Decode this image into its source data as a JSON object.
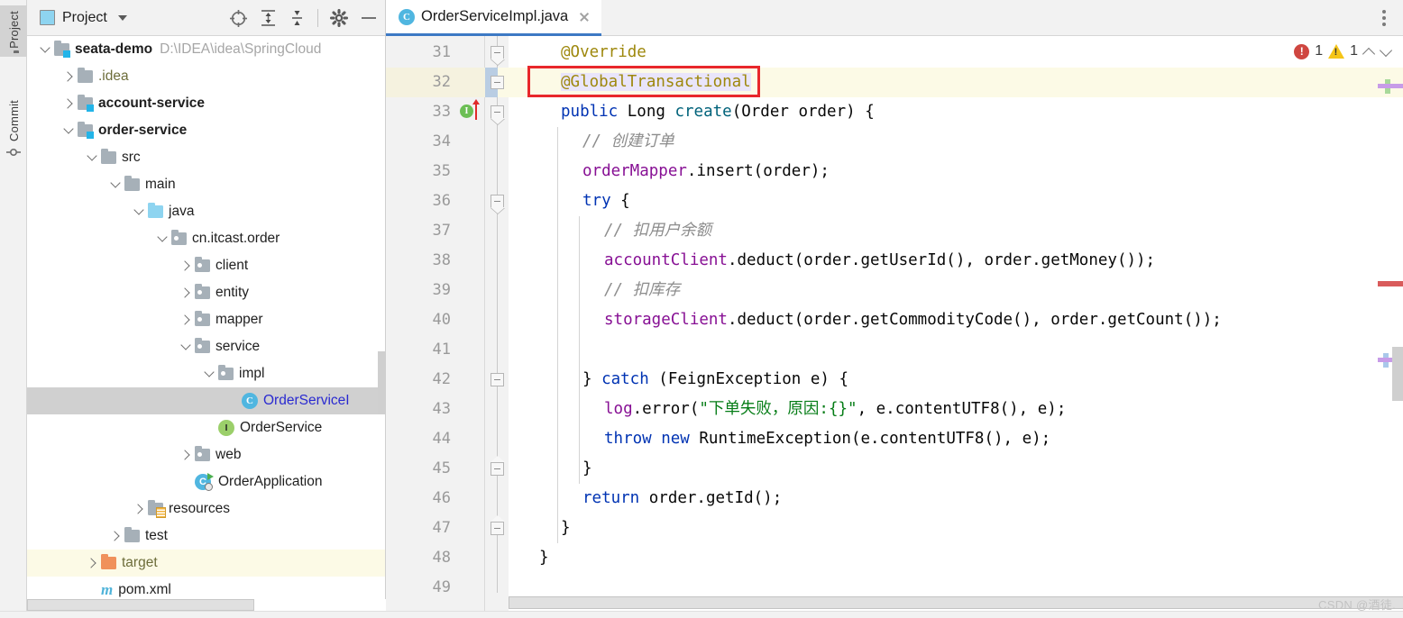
{
  "toolstrip": {
    "items": [
      {
        "label": "Project",
        "icon": "folder-icon",
        "active": true
      },
      {
        "label": "Commit",
        "icon": "commit-icon",
        "active": false
      }
    ]
  },
  "project_panel": {
    "title": "Project",
    "dropdown_icon": "chevron-down-icon",
    "tools": [
      {
        "name": "locate-icon"
      },
      {
        "name": "expand-all-icon"
      },
      {
        "name": "collapse-all-icon"
      },
      {
        "name": "gear-icon"
      },
      {
        "name": "minimize-icon"
      }
    ],
    "tree": [
      {
        "indent": 0,
        "chevron": "down",
        "icon": "module-folder-icon",
        "label": "seata-demo",
        "bold": true,
        "path": "D:\\IDEA\\idea\\SpringCloud"
      },
      {
        "indent": 1,
        "chevron": "right",
        "icon": "folder-icon",
        "label": ".idea",
        "style": "olive"
      },
      {
        "indent": 1,
        "chevron": "right",
        "icon": "module-folder-icon",
        "label": "account-service",
        "bold": true
      },
      {
        "indent": 1,
        "chevron": "down",
        "icon": "module-folder-icon",
        "label": "order-service",
        "bold": true
      },
      {
        "indent": 2,
        "chevron": "down",
        "icon": "folder-icon",
        "label": "src"
      },
      {
        "indent": 3,
        "chevron": "down",
        "icon": "folder-icon",
        "label": "main"
      },
      {
        "indent": 4,
        "chevron": "down",
        "icon": "source-folder-icon",
        "label": "java"
      },
      {
        "indent": 5,
        "chevron": "down",
        "icon": "package-icon",
        "label": "cn.itcast.order"
      },
      {
        "indent": 6,
        "chevron": "right",
        "icon": "package-icon",
        "label": "client"
      },
      {
        "indent": 6,
        "chevron": "right",
        "icon": "package-icon",
        "label": "entity"
      },
      {
        "indent": 6,
        "chevron": "right",
        "icon": "package-icon",
        "label": "mapper"
      },
      {
        "indent": 6,
        "chevron": "down",
        "icon": "package-icon",
        "label": "service"
      },
      {
        "indent": 7,
        "chevron": "down",
        "icon": "package-icon",
        "label": "impl"
      },
      {
        "indent": 8,
        "chevron": "none",
        "icon": "java-class-icon",
        "label": "OrderServiceI",
        "selected": true,
        "style": "blue"
      },
      {
        "indent": 7,
        "chevron": "none",
        "icon": "java-interface-icon",
        "label": "OrderService"
      },
      {
        "indent": 6,
        "chevron": "right",
        "icon": "package-icon",
        "label": "web"
      },
      {
        "indent": 6,
        "chevron": "none",
        "icon": "runnable-class-icon",
        "label": "OrderApplication"
      },
      {
        "indent": 4,
        "chevron": "right",
        "icon": "resources-folder-icon",
        "label": "resources"
      },
      {
        "indent": 3,
        "chevron": "right",
        "icon": "folder-icon",
        "label": "test"
      },
      {
        "indent": 2,
        "chevron": "right",
        "icon": "excluded-folder-icon",
        "label": "target",
        "style": "target",
        "highlight": "yellow"
      },
      {
        "indent": 2,
        "chevron": "none",
        "icon": "maven-icon",
        "label": "pom.xml"
      }
    ]
  },
  "editor": {
    "tab": {
      "label": "OrderServiceImpl.java",
      "icon": "java-class-icon",
      "close_icon": "close-icon"
    },
    "kebab_icon": "more-options-icon",
    "inspections": {
      "error_icon": "error-icon",
      "error_count": "1",
      "warning_icon": "warning-icon",
      "warning_count": "1",
      "prev_icon": "chevron-up-icon",
      "next_icon": "chevron-down-icon"
    },
    "highlight_box_line": "32",
    "lines": [
      {
        "n": "31",
        "indent": 2,
        "fold": "start",
        "tokens": [
          {
            "t": "@Override",
            "c": "ann"
          }
        ]
      },
      {
        "n": "32",
        "indent": 2,
        "fold": "mid",
        "current": true,
        "tokens": [
          {
            "t": "@GlobalTransactional",
            "c": "ann"
          }
        ]
      },
      {
        "n": "33",
        "indent": 2,
        "fold": "start",
        "marker": "implements-override",
        "tokens": [
          {
            "t": "public",
            "c": "kw"
          },
          {
            "t": " "
          },
          {
            "t": "Long",
            "c": "plain"
          },
          {
            "t": " "
          },
          {
            "t": "create",
            "c": "mth"
          },
          {
            "t": "(Order order) {",
            "c": "plain"
          }
        ]
      },
      {
        "n": "34",
        "indent": 3,
        "tokens": [
          {
            "t": "// 创建订单",
            "c": "cmt"
          }
        ]
      },
      {
        "n": "35",
        "indent": 3,
        "tokens": [
          {
            "t": "orderMapper",
            "c": "fld"
          },
          {
            "t": ".insert(order);",
            "c": "plain"
          }
        ]
      },
      {
        "n": "36",
        "indent": 3,
        "fold": "start",
        "tokens": [
          {
            "t": "try",
            "c": "kw"
          },
          {
            "t": " {",
            "c": "plain"
          }
        ]
      },
      {
        "n": "37",
        "indent": 4,
        "tokens": [
          {
            "t": "// 扣用户余额",
            "c": "cmt"
          }
        ]
      },
      {
        "n": "38",
        "indent": 4,
        "tokens": [
          {
            "t": "accountClient",
            "c": "fld"
          },
          {
            "t": ".deduct(order.getUserId(), order.getMoney());",
            "c": "plain"
          }
        ]
      },
      {
        "n": "39",
        "indent": 4,
        "tokens": [
          {
            "t": "// 扣库存",
            "c": "cmt"
          }
        ]
      },
      {
        "n": "40",
        "indent": 4,
        "tokens": [
          {
            "t": "storageClient",
            "c": "fld"
          },
          {
            "t": ".deduct(order.getCommodityCode(), order.getCount());",
            "c": "plain"
          }
        ]
      },
      {
        "n": "41",
        "indent": 4,
        "tokens": []
      },
      {
        "n": "42",
        "indent": 3,
        "fold": "mid",
        "tokens": [
          {
            "t": "} ",
            "c": "plain"
          },
          {
            "t": "catch",
            "c": "kw"
          },
          {
            "t": " (FeignException e) {",
            "c": "plain"
          }
        ]
      },
      {
        "n": "43",
        "indent": 4,
        "tokens": [
          {
            "t": "log",
            "c": "fld"
          },
          {
            "t": ".error(",
            "c": "plain"
          },
          {
            "t": "\"下单失败，原因:{}\"",
            "c": "str"
          },
          {
            "t": ", e.contentUTF8(), e);",
            "c": "plain"
          }
        ]
      },
      {
        "n": "44",
        "indent": 4,
        "tokens": [
          {
            "t": "throw",
            "c": "kw"
          },
          {
            "t": " "
          },
          {
            "t": "new",
            "c": "kw"
          },
          {
            "t": " RuntimeException(e.contentUTF8(), e);",
            "c": "plain"
          }
        ]
      },
      {
        "n": "45",
        "indent": 3,
        "fold": "end",
        "tokens": [
          {
            "t": "}",
            "c": "plain"
          }
        ]
      },
      {
        "n": "46",
        "indent": 3,
        "tokens": [
          {
            "t": "return",
            "c": "kw"
          },
          {
            "t": " order.getId();",
            "c": "plain"
          }
        ]
      },
      {
        "n": "47",
        "indent": 2,
        "fold": "end",
        "tokens": [
          {
            "t": "}",
            "c": "plain"
          }
        ]
      },
      {
        "n": "48",
        "indent": 1,
        "tokens": [
          {
            "t": "}",
            "c": "plain"
          }
        ]
      },
      {
        "n": "49",
        "indent": 0,
        "tokens": []
      }
    ]
  },
  "watermark": "CSDN @酒徒.",
  "colors": {
    "accent": "#3d79c4",
    "annotation": "#9e880d",
    "keyword": "#0033b3",
    "string": "#067d17",
    "comment": "#8c8c8c",
    "field": "#871094",
    "method": "#00627a",
    "error": "#cf4640",
    "warning": "#f5c518",
    "highlight_box": "#e8272b",
    "current_line": "#fcfae6"
  }
}
